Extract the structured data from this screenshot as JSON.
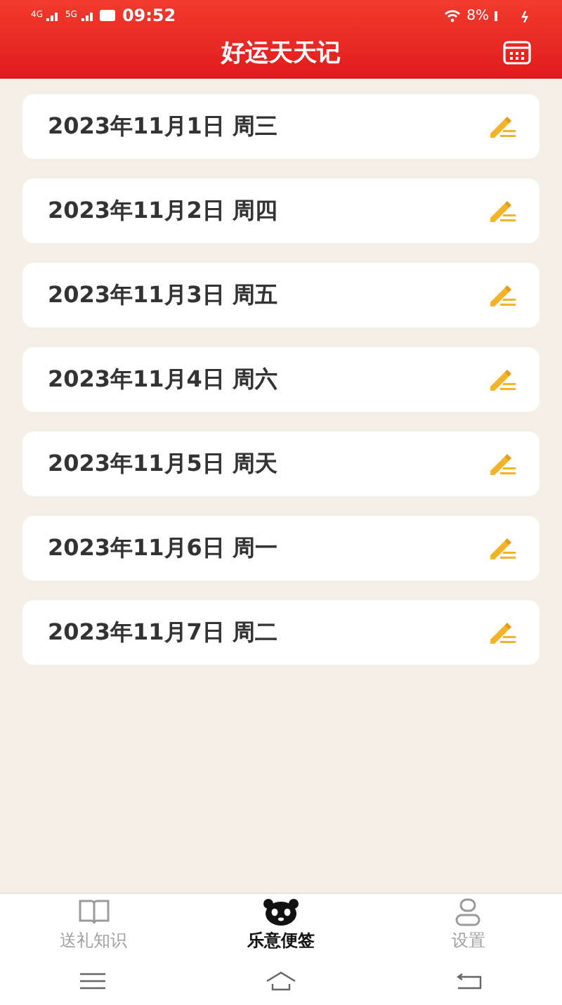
{
  "status_bar": {
    "network_1": "4G",
    "network_2": "5G",
    "time": "09:52",
    "battery": "8%"
  },
  "header": {
    "title": "好运天天记"
  },
  "entries": [
    {
      "date": "2023年11月1日 周三"
    },
    {
      "date": "2023年11月2日 周四"
    },
    {
      "date": "2023年11月3日 周五"
    },
    {
      "date": "2023年11月4日 周六"
    },
    {
      "date": "2023年11月5日 周天"
    },
    {
      "date": "2023年11月6日 周一"
    },
    {
      "date": "2023年11月7日 周二"
    }
  ],
  "tabs": [
    {
      "label": "送礼知识",
      "kind": "book",
      "selected": false
    },
    {
      "label": "乐意便签",
      "kind": "panda",
      "selected": true
    },
    {
      "label": "设置",
      "kind": "person",
      "selected": false
    }
  ]
}
